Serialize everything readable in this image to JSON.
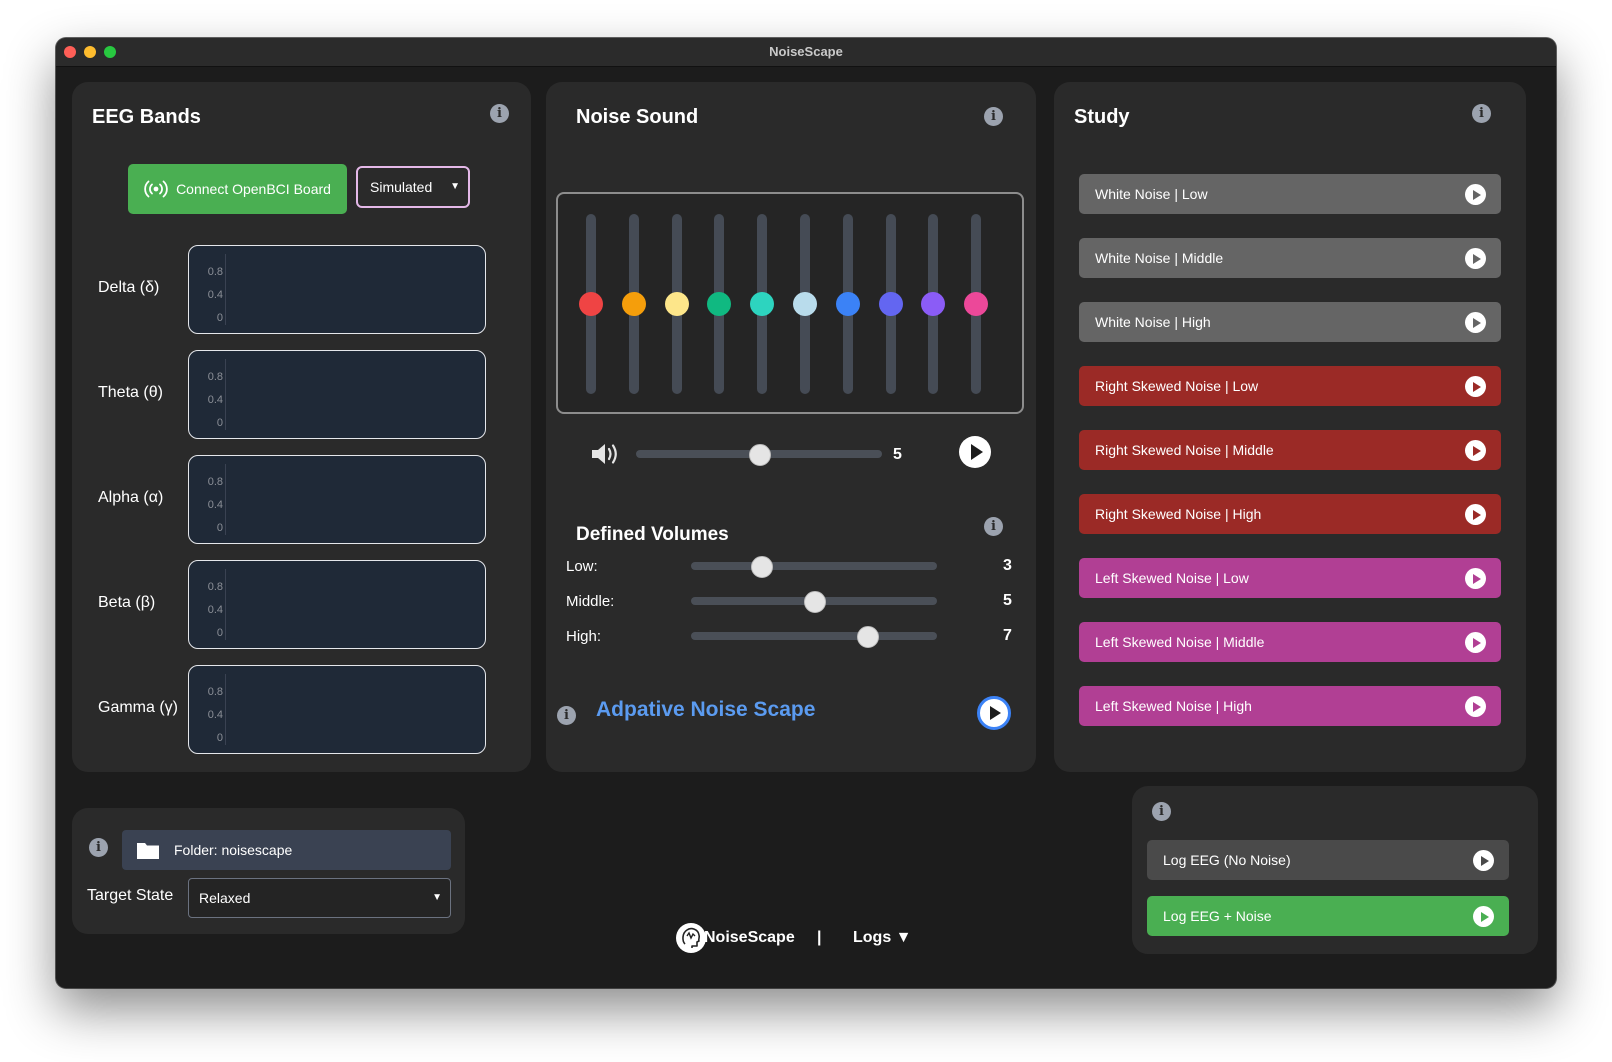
{
  "window": {
    "title": "NoiseScape"
  },
  "eeg": {
    "title": "EEG Bands",
    "connect_label": "Connect OpenBCI Board",
    "mode_value": "Simulated",
    "ticks": [
      "0.8",
      "0.4",
      "0"
    ],
    "bands": [
      "Delta (δ)",
      "Theta (θ)",
      "Alpha (α)",
      "Beta (β)",
      "Gamma (γ)"
    ]
  },
  "noise": {
    "title": "Noise Sound",
    "eq_colors": [
      "#ef4444",
      "#f59e0b",
      "#fde68a",
      "#10b981",
      "#2dd4bf",
      "#b9dcec",
      "#3b82f6",
      "#6366f1",
      "#8b5cf6",
      "#ec4899"
    ],
    "eq_levels": [
      0.5,
      0.5,
      0.5,
      0.5,
      0.5,
      0.5,
      0.5,
      0.5,
      0.5,
      0.5
    ],
    "volume_value": "5",
    "volume_fraction": 0.5
  },
  "defined_volumes": {
    "title": "Defined Volumes",
    "rows": [
      {
        "label": "Low:",
        "value": "3",
        "fraction": 0.285
      },
      {
        "label": "Middle:",
        "value": "5",
        "fraction": 0.5
      },
      {
        "label": "High:",
        "value": "7",
        "fraction": 0.715
      }
    ]
  },
  "adaptive": {
    "label": "Adpative Noise Scape"
  },
  "study": {
    "title": "Study",
    "buttons": [
      {
        "label": "White Noise | Low",
        "color": "#656565"
      },
      {
        "label": "White Noise | Middle",
        "color": "#656565"
      },
      {
        "label": "White Noise | High",
        "color": "#656565"
      },
      {
        "label": "Right Skewed Noise | Low",
        "color": "#9b2a26"
      },
      {
        "label": "Right Skewed Noise | Middle",
        "color": "#9b2a26"
      },
      {
        "label": "Right Skewed Noise | High",
        "color": "#9b2a26"
      },
      {
        "label": "Left Skewed Noise | Low",
        "color": "#b13f94"
      },
      {
        "label": "Left Skewed Noise | Middle",
        "color": "#b13f94"
      },
      {
        "label": "Left Skewed Noise | High",
        "color": "#b13f94"
      }
    ]
  },
  "settings": {
    "folder_label": "Folder: noisescape",
    "target_label": "Target State",
    "target_value": "Relaxed"
  },
  "log": {
    "buttons": [
      {
        "label": "Log EEG (No Noise)",
        "color": "#4a4a4a"
      },
      {
        "label": "Log EEG + Noise",
        "color": "#4aaf52"
      }
    ]
  },
  "footer": {
    "app_name": "NoiseScape",
    "separator": "|",
    "logs_label": "Logs ▼"
  }
}
